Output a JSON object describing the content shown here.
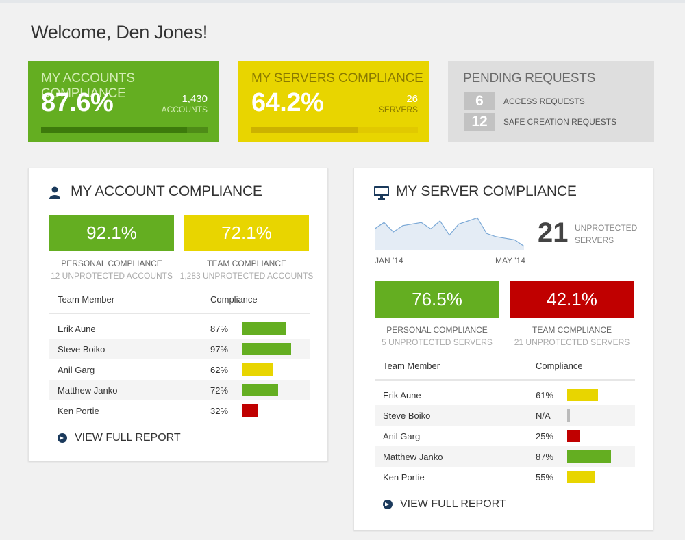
{
  "welcome": "Welcome, Den Jones!",
  "cards": {
    "accounts": {
      "title": "MY ACCOUNTS COMPLIANCE",
      "value": "87.6%",
      "count": "1,430",
      "unit": "ACCOUNTS",
      "progress": 0.876
    },
    "servers": {
      "title": "MY SERVERS COMPLIANCE",
      "value": "64.2%",
      "count": "26",
      "unit": "SERVERS",
      "progress": 0.642
    },
    "pending": {
      "title": "PENDING REQUESTS",
      "rows": [
        {
          "num": "6",
          "label": "ACCESS REQUESTS"
        },
        {
          "num": "12",
          "label": "SAFE CREATION REQUESTS"
        }
      ]
    }
  },
  "account_panel": {
    "title": "MY ACCOUNT COMPLIANCE",
    "icon": "user-icon",
    "personal": {
      "value": "92.1%",
      "label": "PERSONAL COMPLIANCE",
      "sub": "12 UNPROTECTED ACCOUNTS"
    },
    "team": {
      "value": "72.1%",
      "label": "TEAM COMPLIANCE",
      "sub": "1,283 UNPROTECTED ACCOUNTS"
    },
    "table": {
      "headers": [
        "Team Member",
        "Compliance"
      ],
      "rows": [
        {
          "name": "Erik Aune",
          "pct": "87%",
          "value": 87,
          "color": "#64ae21"
        },
        {
          "name": "Steve Boiko",
          "pct": "97%",
          "value": 97,
          "color": "#64ae21"
        },
        {
          "name": "Anil Garg",
          "pct": "62%",
          "value": 62,
          "color": "#e8d500"
        },
        {
          "name": "Matthew Janko",
          "pct": "72%",
          "value": 72,
          "color": "#64ae21"
        },
        {
          "name": "Ken Portie",
          "pct": "32%",
          "value": 32,
          "color": "#c00000"
        }
      ]
    },
    "view_report": "VIEW FULL REPORT"
  },
  "server_panel": {
    "title": "MY SERVER COMPLIANCE",
    "icon": "monitor-icon",
    "sparkline": {
      "start_label": "JAN '14",
      "end_label": "MAY '14",
      "values": [
        0.6,
        0.8,
        0.5,
        0.7,
        0.75,
        0.8,
        0.6,
        0.85,
        0.4,
        0.75,
        0.85,
        0.95,
        0.45,
        0.35,
        0.3,
        0.25,
        0.05
      ]
    },
    "unprotected": {
      "num": "21",
      "label1": "UNPROTECTED",
      "label2": "SERVERS"
    },
    "personal": {
      "value": "76.5%",
      "label": "PERSONAL COMPLIANCE",
      "sub": "5 UNPROTECTED SERVERS"
    },
    "team": {
      "value": "42.1%",
      "label": "TEAM COMPLIANCE",
      "sub": "21 UNPROTECTED SERVERS"
    },
    "table": {
      "headers": [
        "Team Member",
        "Compliance"
      ],
      "rows": [
        {
          "name": "Erik Aune",
          "pct": "61%",
          "value": 61,
          "color": "#e8d500"
        },
        {
          "name": "Steve Boiko",
          "pct": "N/A",
          "value": 6,
          "color": "#bbbbbb"
        },
        {
          "name": "Anil Garg",
          "pct": "25%",
          "value": 25,
          "color": "#c00000"
        },
        {
          "name": "Matthew Janko",
          "pct": "87%",
          "value": 87,
          "color": "#64ae21"
        },
        {
          "name": "Ken Portie",
          "pct": "55%",
          "value": 55,
          "color": "#e8d500"
        }
      ]
    },
    "view_report": "VIEW FULL REPORT"
  }
}
